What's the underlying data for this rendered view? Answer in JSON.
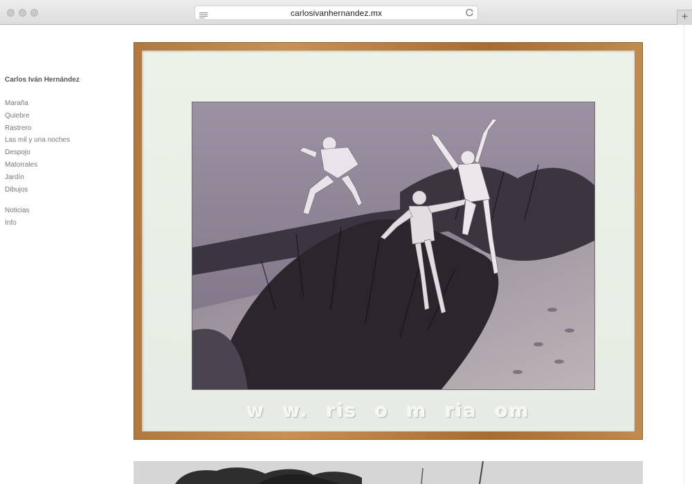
{
  "browser": {
    "url": "carlosivanhernandez.mx",
    "icons": {
      "reader": "reader-view-icon",
      "reload": "reload-icon",
      "new_tab": "plus-icon"
    },
    "new_tab_label": "+"
  },
  "site": {
    "title": "Carlos Iván Hernández",
    "nav_primary": [
      {
        "label": "Maraña"
      },
      {
        "label": "Quiebre"
      },
      {
        "label": "Rastrero"
      },
      {
        "label": "Las mil y una noches"
      },
      {
        "label": "Despojo"
      },
      {
        "label": "Matorrales"
      },
      {
        "label": "Jardín"
      },
      {
        "label": "Dibujos"
      }
    ],
    "nav_secondary": [
      {
        "label": "Noticias"
      },
      {
        "label": "Info"
      }
    ]
  },
  "gallery": {
    "artwork_1": {
      "mat_lettering": "w w. ris o m ria om",
      "colors": {
        "frame": "#b98148",
        "mat": "#e9efe6",
        "photo_tint": "#8d8593"
      }
    }
  }
}
